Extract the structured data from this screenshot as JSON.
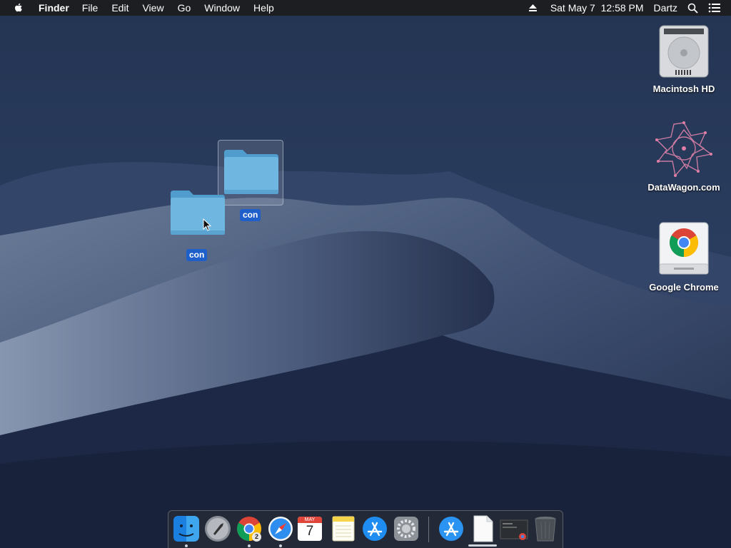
{
  "menubar": {
    "app_name": "Finder",
    "menus": [
      "File",
      "Edit",
      "View",
      "Go",
      "Window",
      "Help"
    ],
    "clock": "Sat May 7  12:58 PM",
    "user": "Dartz",
    "icons": [
      "apple-icon",
      "eject-icon",
      "spotlight-search-icon",
      "notification-center-icon"
    ]
  },
  "desktop": {
    "folders": [
      {
        "label": "con",
        "selected": true
      },
      {
        "label": "con",
        "selected": true
      }
    ],
    "right_icons": [
      {
        "label": "Macintosh HD",
        "icon": "hard-drive-icon"
      },
      {
        "label": "DataWagon.com",
        "icon": "datawagon-volume-icon"
      },
      {
        "label": "Google Chrome",
        "icon": "chrome-disk-image-icon"
      }
    ]
  },
  "dock": {
    "apps": [
      "Finder",
      "Launchpad",
      "Google Chrome",
      "Safari",
      "Calendar",
      "Notes",
      "App Store",
      "System Preferences"
    ],
    "chrome_badge": "2",
    "calendar": {
      "month": "MAY",
      "day": "7"
    },
    "right_items": [
      "App Store Downloads",
      "Document",
      "Chrome Window",
      "Trash"
    ]
  },
  "colors": {
    "menubar": "#1c1c1e",
    "selection_label": "#1e5fc9",
    "folder_blue": "#6fb7e0",
    "wallpaper_sky": "#1d2a44"
  }
}
